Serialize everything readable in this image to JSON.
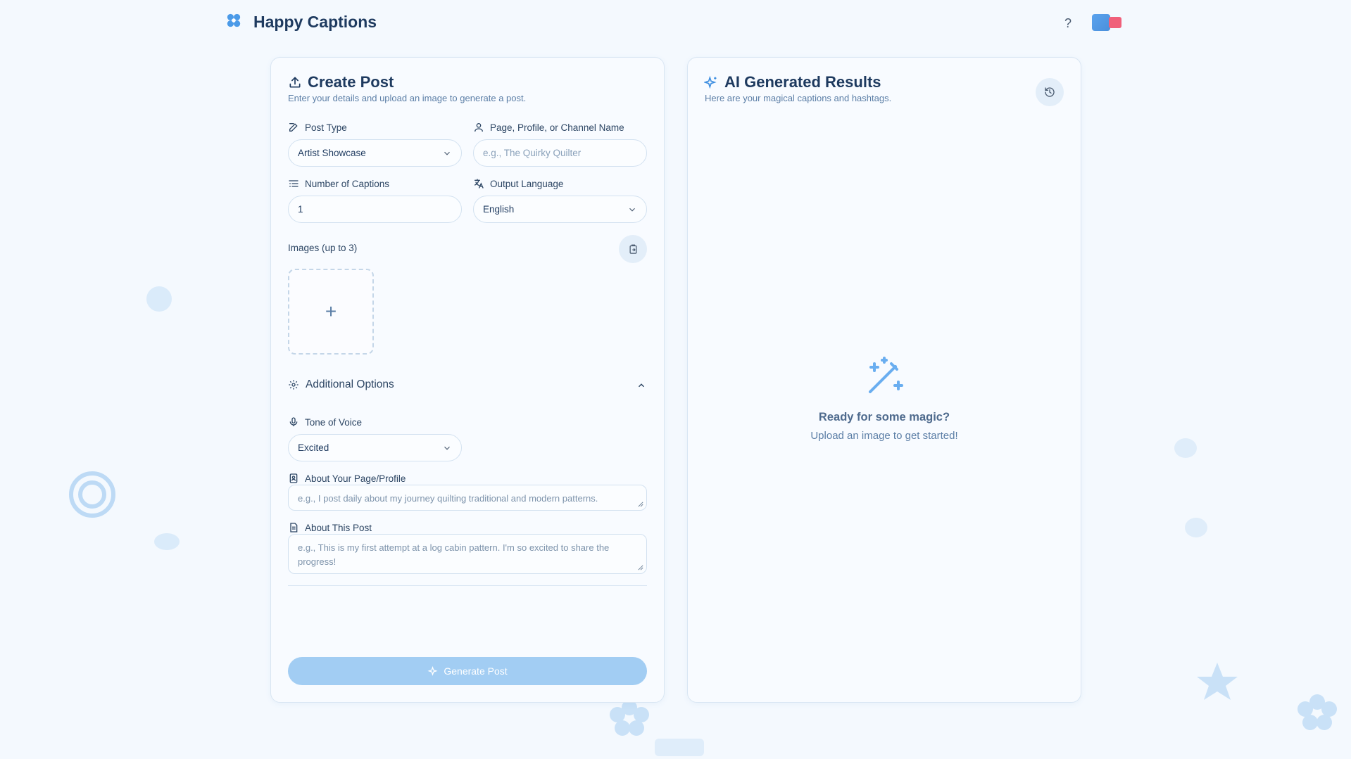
{
  "app": {
    "title": "Happy Captions"
  },
  "header": {
    "help_label": "?"
  },
  "create": {
    "title": "Create Post",
    "subtitle": "Enter your details and upload an image to generate a post.",
    "post_type": {
      "label": "Post Type",
      "value": "Artist Showcase"
    },
    "page_name": {
      "label": "Page, Profile, or Channel Name",
      "placeholder": "e.g., The Quirky Quilter"
    },
    "num_captions": {
      "label": "Number of Captions",
      "value": "1"
    },
    "language": {
      "label": "Output Language",
      "value": "English"
    },
    "images": {
      "label": "Images (up to 3)",
      "add": "+"
    },
    "additional": {
      "label": "Additional Options",
      "tone": {
        "label": "Tone of Voice",
        "value": "Excited"
      },
      "about_page": {
        "label": "About Your Page/Profile",
        "placeholder": "e.g., I post daily about my journey quilting traditional and modern patterns."
      },
      "about_post": {
        "label": "About This Post",
        "placeholder": "e.g., This is my first attempt at a log cabin pattern. I'm so excited to share the progress!"
      }
    },
    "generate_label": "Generate Post"
  },
  "results": {
    "title": "AI Generated Results",
    "subtitle": "Here are your magical captions and hashtags.",
    "empty_title": "Ready for some magic?",
    "empty_sub": "Upload an image to get started!"
  },
  "colors": {
    "accent": "#4a9ae8",
    "button_disabled": "#a2cdf3",
    "toggle_red": "#f0607a"
  },
  "icons": [
    "flower-logo-icon",
    "help-icon",
    "upload-icon",
    "edit-icon",
    "user-icon",
    "list-icon",
    "translate-icon",
    "chevron-down-icon",
    "paste-icon",
    "plus-icon",
    "gear-icon",
    "chevron-up-icon",
    "mic-icon",
    "id-card-icon",
    "document-icon",
    "sparkles-icon",
    "history-icon",
    "magic-wand-icon"
  ]
}
